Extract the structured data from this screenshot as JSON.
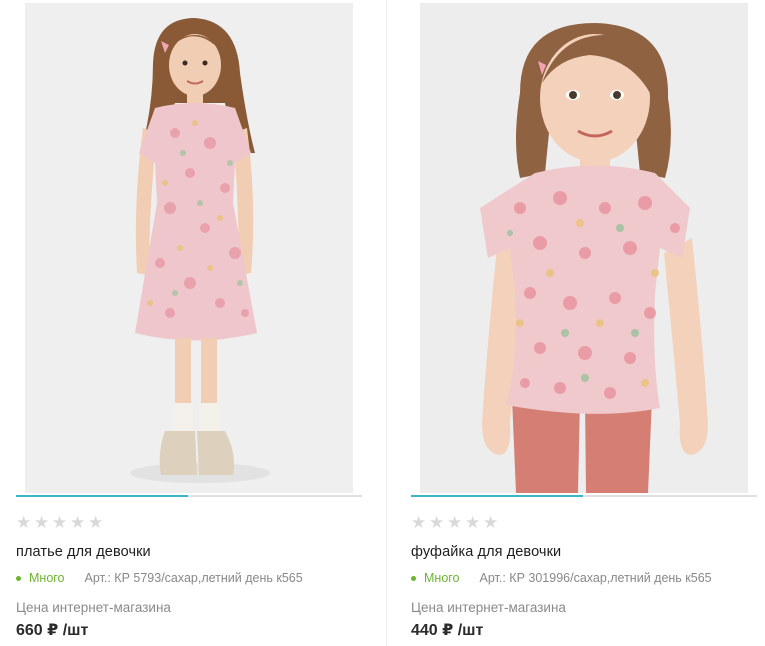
{
  "products": [
    {
      "name": "платье для девочки",
      "stock": "Много",
      "article": "Арт.: КР 5793/сахар,летний день к565",
      "price_label": "Цена интернет-магазина",
      "price": "660 ₽ /шт",
      "rating": 0,
      "image": "girl-in-floral-dress-photo"
    },
    {
      "name": "фуфайка для девочки",
      "stock": "Много",
      "article": "Арт.: КР 301996/сахар,летний день к565",
      "price_label": "Цена интернет-магазина",
      "price": "440 ₽ /шт",
      "rating": 0,
      "image": "girl-in-floral-tshirt-photo"
    }
  ],
  "colors": {
    "accent": "#3cb5c8",
    "stock": "#6bb52f",
    "star_empty": "#d9d9d9"
  }
}
